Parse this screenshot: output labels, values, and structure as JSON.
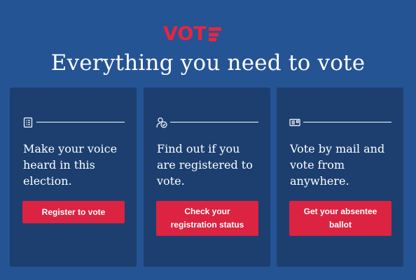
{
  "header": {
    "logo_text": "VOT",
    "title": "Everything you need to vote"
  },
  "cards": [
    {
      "icon": "checklist-icon",
      "text": "Make your voice heard in this election.",
      "button": "Register to vote"
    },
    {
      "icon": "person-check-icon",
      "text": "Find out if you are registered to vote.",
      "button": "Check your registration status"
    },
    {
      "icon": "envelope-icon",
      "text": "Vote by mail and vote from anywhere.",
      "button": "Get your absentee ballot"
    }
  ],
  "colors": {
    "background": "#245493",
    "card": "#1c3f70",
    "accent": "#dc2341",
    "logo": "#e8253f"
  }
}
